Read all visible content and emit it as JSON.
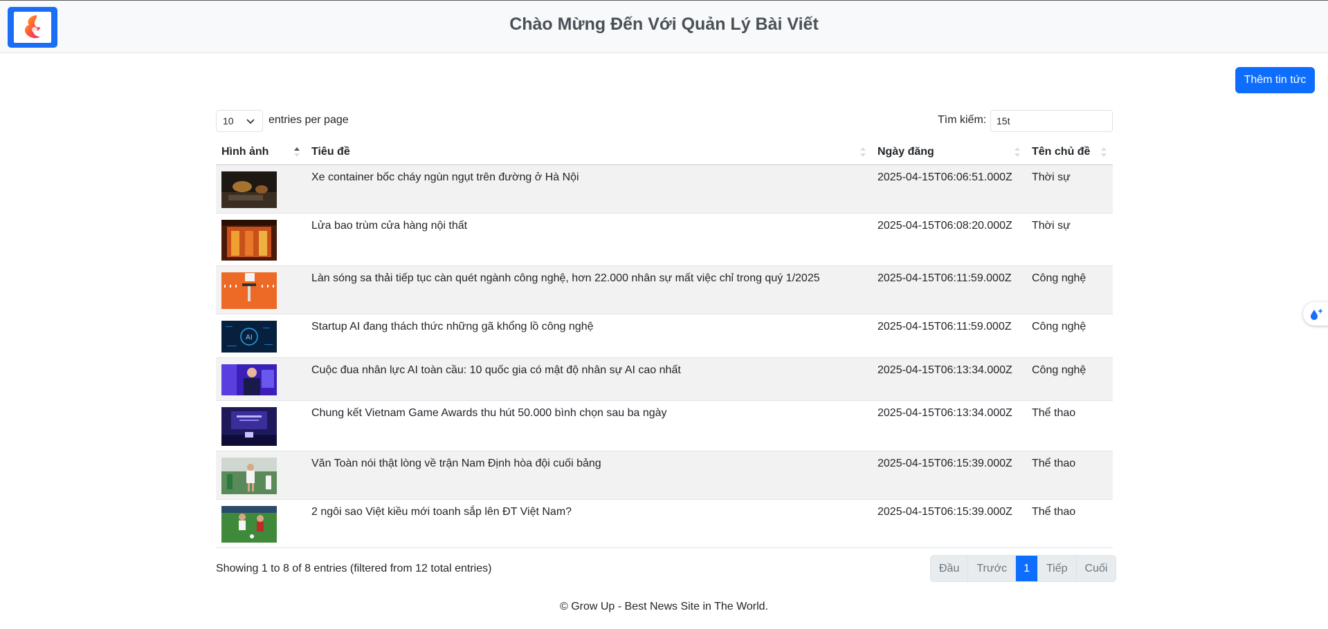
{
  "header": {
    "title": "Chào Mừng Đến Với Quản Lý Bài Viết",
    "logo_icon": "app-logo-icon"
  },
  "toolbar": {
    "add_label": "Thêm tin tức"
  },
  "table_controls": {
    "page_length": "10",
    "page_length_suffix": "entries per page",
    "search_label": "Tìm kiếm:",
    "search_value": "15t"
  },
  "table": {
    "columns": [
      "Hình ảnh",
      "Tiêu đề",
      "Ngày đăng",
      "Tên chủ đề"
    ],
    "sorted_column": "Hình ảnh",
    "sort_direction": "ascending",
    "rows": [
      {
        "title": "Xe container bốc cháy ngùn ngụt trên đường ở Hà Nội",
        "date": "2025-04-15T06:06:51.000Z",
        "topic": "Thời sự",
        "thumb": "fire-night-truck"
      },
      {
        "title": "Lửa bao trùm cửa hàng nội thất",
        "date": "2025-04-15T06:08:20.000Z",
        "topic": "Thời sự",
        "thumb": "fire-building"
      },
      {
        "title": "Làn sóng sa thải tiếp tục càn quét ngành công nghệ, hơn 22.000 nhân sự mất việc chỉ trong quý 1/2025",
        "date": "2025-04-15T06:11:59.000Z",
        "topic": "Công nghệ",
        "thumb": "orange-illustration"
      },
      {
        "title": "Startup AI đang thách thức những gã khổng lồ công nghệ",
        "date": "2025-04-15T06:11:59.000Z",
        "topic": "Công nghệ",
        "thumb": "ai-blue"
      },
      {
        "title": "Cuộc đua nhân lực AI toàn cầu: 10 quốc gia có mật độ nhân sự AI cao nhất",
        "date": "2025-04-15T06:13:34.000Z",
        "topic": "Công nghệ",
        "thumb": "person-purple"
      },
      {
        "title": "Chung kết Vietnam Game Awards thu hút 50.000 bình chọn sau ba ngày",
        "date": "2025-04-15T06:13:34.000Z",
        "topic": "Thể thao",
        "thumb": "stage-event"
      },
      {
        "title": "Văn Toàn nói thật lòng về trận Nam Định hòa đội cuối bảng",
        "date": "2025-04-15T06:15:39.000Z",
        "topic": "Thể thao",
        "thumb": "football-player"
      },
      {
        "title": "2 ngôi sao Việt kiều mới toanh sắp lên ĐT Việt Nam?",
        "date": "2025-04-15T06:15:39.000Z",
        "topic": "Thể thao",
        "thumb": "football-match"
      }
    ]
  },
  "footer_info": {
    "showing": "Showing 1 to 8 of 8 entries (filtered from 12 total entries)"
  },
  "pagination": {
    "first": "Đầu",
    "prev": "Trước",
    "current": "1",
    "next": "Tiếp",
    "last": "Cuối"
  },
  "footer": {
    "copyright": "© Grow Up - Best News Site in The World."
  },
  "side_widget": {
    "icon": "sparkle-drop-icon"
  },
  "colors": {
    "primary": "#0d6efd",
    "header_bg": "#f8f9fa",
    "stripe": "#f2f2f2"
  }
}
